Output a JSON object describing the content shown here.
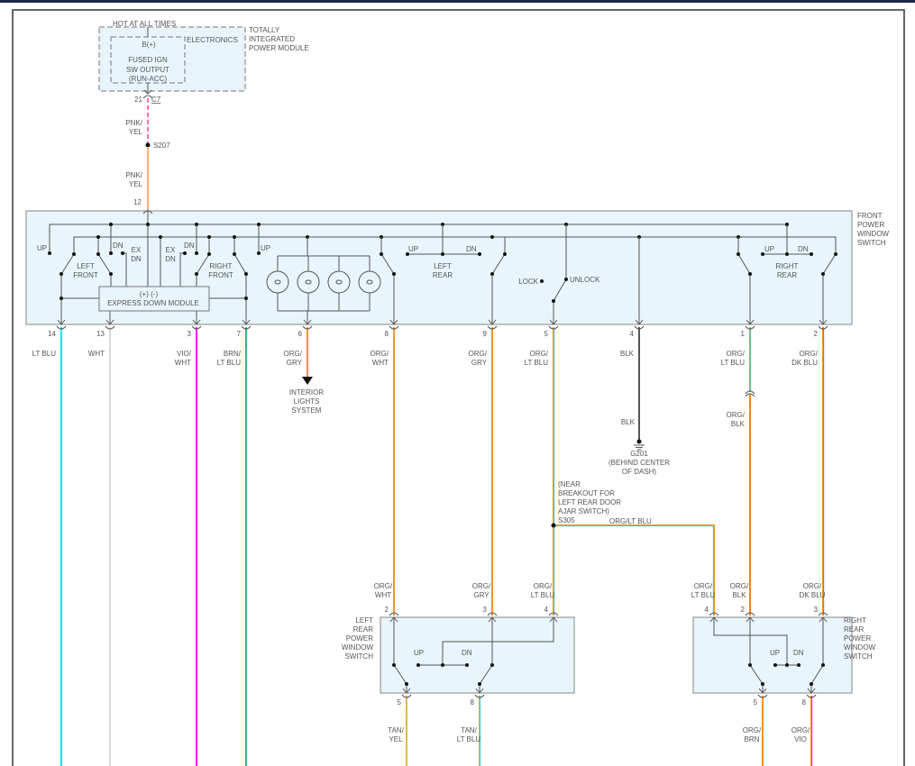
{
  "colors": {
    "orange": "#f7941d",
    "lt_blu": "#00e5ff",
    "wht": "#d8d8d8",
    "vio": "#ff00ff",
    "brn": "#7c8f3a",
    "pink": "#ff6fa8",
    "blk": "#555555",
    "tan": "#c9b36a",
    "yel": "#ffd800",
    "box_fill": "#e8f5fc"
  },
  "tipm": {
    "hot": "HOT AT ALL TIMES",
    "bplus": "B(+)",
    "fused": [
      "FUSED IGN",
      "SW OUTPUT",
      "(RUN-ACC)"
    ],
    "electronics": "ELECTRONICS",
    "name": [
      "TOTALLY",
      "INTEGRATED",
      "POWER MODULE"
    ],
    "pin": "21",
    "connector": "C7"
  },
  "feed": {
    "wire_upper": [
      "PNK/",
      "YEL"
    ],
    "splice": "S207",
    "wire_lower": [
      "PNK/",
      "YEL"
    ],
    "pin": "12"
  },
  "front_switch": {
    "name": [
      "FRONT",
      "POWER",
      "WINDOW",
      "SWITCH"
    ],
    "labels": {
      "up1": "UP",
      "left_front": [
        "LEFT",
        "FRONT"
      ],
      "dn1": "DN",
      "exdn1": [
        "EX",
        "DN"
      ],
      "exdn2": [
        "EX",
        "DN"
      ],
      "dn2": "DN",
      "right_front": [
        "RIGHT",
        "FRONT"
      ],
      "up2": "UP",
      "lr_up": "UP",
      "lr_dn": "DN",
      "left_rear": [
        "LEFT",
        "REAR"
      ],
      "lock": "LOCK",
      "unlock": "UNLOCK",
      "rr_up": "UP",
      "rr_dn": "DN",
      "right_rear": [
        "RIGHT",
        "REAR"
      ]
    },
    "module": {
      "polarity": "(+)  (-)",
      "name": "EXPRESS DOWN MODULE"
    },
    "pins": [
      {
        "pin": "14",
        "wire": [
          "LT BLU",
          ""
        ]
      },
      {
        "pin": "13",
        "wire": [
          "WHT",
          ""
        ]
      },
      {
        "pin": "3",
        "wire": [
          "VIO/",
          "WHT"
        ]
      },
      {
        "pin": "7",
        "wire": [
          "BRN/",
          "LT BLU"
        ]
      },
      {
        "pin": "6",
        "wire": [
          "ORG/",
          "GRY"
        ]
      },
      {
        "pin": "8",
        "wire": [
          "ORG/",
          "WHT"
        ]
      },
      {
        "pin": "9",
        "wire": [
          "ORG/",
          "GRY"
        ]
      },
      {
        "pin": "5",
        "wire": [
          "ORG/",
          "LT BLU"
        ]
      },
      {
        "pin": "4",
        "wire": [
          "BLK",
          ""
        ]
      },
      {
        "pin": "1",
        "wire": [
          "ORG/",
          "LT BLU"
        ]
      },
      {
        "pin": "2",
        "wire": [
          "ORG/",
          "DK BLU"
        ]
      }
    ]
  },
  "interior_lights": [
    "INTERIOR",
    "LIGHTS",
    "SYSTEM"
  ],
  "ground": {
    "wire": "BLK",
    "id": "G201",
    "location": [
      "(BEHIND CENTER",
      "OF DASH)"
    ]
  },
  "org_blk": [
    "ORG/",
    "BLK"
  ],
  "s305": {
    "note": [
      "(NEAR",
      "BREAKOUT FOR",
      "LEFT REAR DOOR",
      "AJAR SWITCH)"
    ],
    "id": "S305",
    "wire": "ORG/LT BLU"
  },
  "left_rear_switch": {
    "name": [
      "LEFT",
      "REAR",
      "POWER",
      "WINDOW",
      "SWITCH"
    ],
    "up": "UP",
    "dn": "DN",
    "top_pins": [
      {
        "pin": "2",
        "wire": [
          "ORG/",
          "WHT"
        ]
      },
      {
        "pin": "3",
        "wire": [
          "ORG/",
          "GRY"
        ]
      },
      {
        "pin": "4",
        "wire": [
          "ORG/",
          "LT BLU"
        ]
      }
    ],
    "bottom_pins": [
      {
        "pin": "5",
        "wire": [
          "TAN/",
          "YEL"
        ]
      },
      {
        "pin": "8",
        "wire": [
          "TAN/",
          "LT BLU"
        ]
      }
    ]
  },
  "right_rear_switch": {
    "name": [
      "RIGHT",
      "REAR",
      "POWER",
      "WINDOW",
      "SWITCH"
    ],
    "up": "UP",
    "dn": "DN",
    "top_pins": [
      {
        "pin": "4",
        "wire": [
          "ORG/",
          "LT BLU"
        ]
      },
      {
        "pin": "2",
        "wire": [
          "ORG/",
          "BLK"
        ]
      },
      {
        "pin": "3",
        "wire": [
          "ORG/",
          "DK BLU"
        ]
      }
    ],
    "bottom_pins": [
      {
        "pin": "5",
        "wire": [
          "ORG/",
          "BRN"
        ]
      },
      {
        "pin": "8",
        "wire": [
          "ORG/",
          "VIO"
        ]
      }
    ]
  }
}
